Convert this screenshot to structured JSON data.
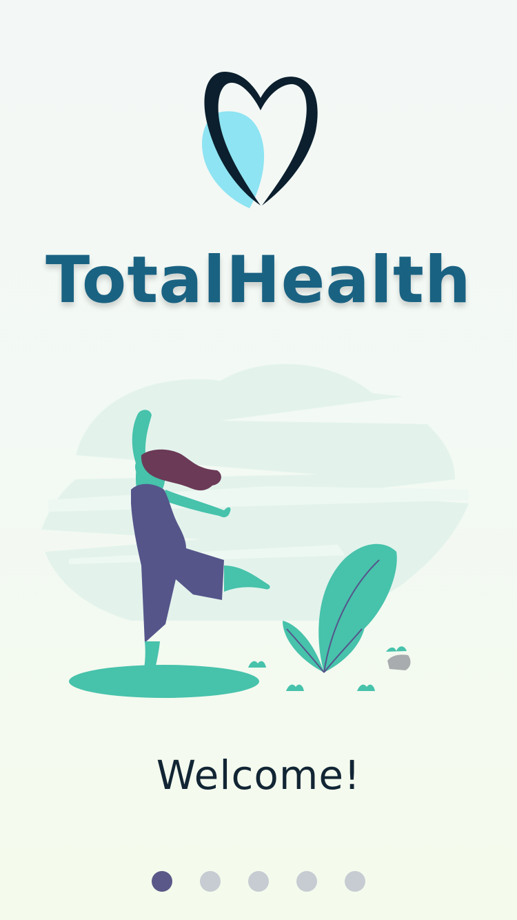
{
  "app": {
    "name": "TotalHealth"
  },
  "onboarding": {
    "welcome_text": "Welcome!",
    "current_page": 1,
    "total_pages": 5
  },
  "colors": {
    "brand": "#1a6282",
    "logo_dark": "#0c1f2e",
    "logo_light": "#8ee4f2",
    "accent_green": "#47c2ab",
    "figure_purple": "#55558a",
    "hair": "#6b3a57",
    "dot_active": "#5a5888",
    "dot_inactive": "#c6ccd2"
  },
  "icons": {
    "logo": "heart-logo-icon",
    "illustration": "dancing-woman-illustration",
    "plant": "plant-icon"
  }
}
